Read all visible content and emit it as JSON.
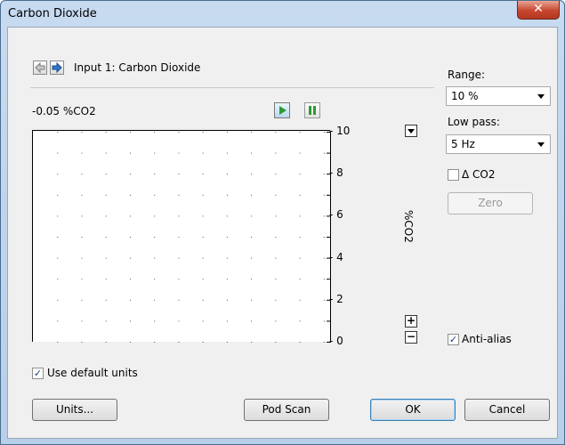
{
  "window": {
    "title": "Carbon Dioxide"
  },
  "header": {
    "input_label": "Input 1: Carbon Dioxide"
  },
  "reading": {
    "value": "-0.05 %CO2"
  },
  "chart_data": {
    "type": "line",
    "title": "",
    "ylabel": "%CO2",
    "ylim": [
      0,
      10
    ],
    "yticks": [
      "10",
      "8",
      "6",
      "4",
      "2",
      "0"
    ],
    "grid": true,
    "series": []
  },
  "range": {
    "label": "Range:",
    "value": "10 %"
  },
  "low_pass": {
    "label": "Low pass:",
    "value": "5 Hz"
  },
  "delta": {
    "label": "Δ CO2",
    "checked": false
  },
  "zero_button": "Zero",
  "anti_alias": {
    "label": "Anti-alias",
    "checked": true
  },
  "use_default_units": {
    "label": "Use default units",
    "checked": true
  },
  "buttons": {
    "units": "Units...",
    "pod_scan": "Pod Scan",
    "ok": "OK",
    "cancel": "Cancel"
  }
}
